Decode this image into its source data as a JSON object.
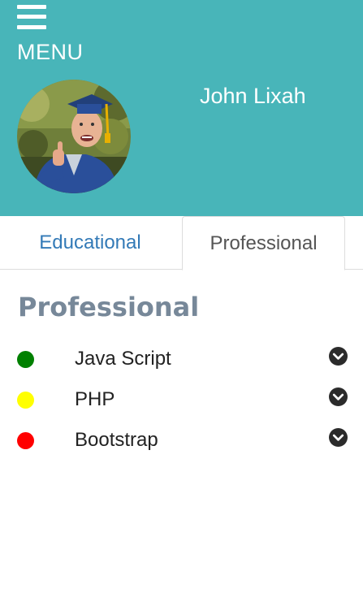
{
  "header": {
    "menu_label": "MENU",
    "user_name": "John Lixah",
    "background_color": "#48b5b9",
    "avatar_alt": "graduate-photo"
  },
  "tabs": [
    {
      "label": "Educational",
      "active": false
    },
    {
      "label": "Professional",
      "active": true
    }
  ],
  "section": {
    "title": "Professional"
  },
  "skills": [
    {
      "name": "Java Script",
      "color": "#008000",
      "icon": "chevron-down-icon"
    },
    {
      "name": "PHP",
      "color": "#ffff00",
      "icon": "chevron-down-icon"
    },
    {
      "name": "Bootstrap",
      "color": "#ff0000",
      "icon": "chevron-down-icon"
    }
  ]
}
